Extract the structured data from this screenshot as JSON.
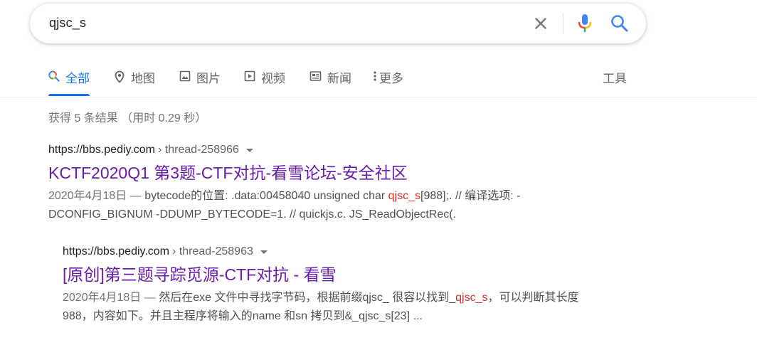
{
  "search": {
    "query": "qjsc_s"
  },
  "tabs": [
    {
      "label": "全部",
      "icon": "search-multicolor-icon",
      "active": true
    },
    {
      "label": "地图",
      "icon": "map-pin-icon"
    },
    {
      "label": "图片",
      "icon": "image-icon"
    },
    {
      "label": "视频",
      "icon": "video-play-icon"
    },
    {
      "label": "新闻",
      "icon": "news-icon"
    },
    {
      "label": "更多",
      "icon": "more-vert-icon"
    }
  ],
  "tools_label": "工具",
  "result_stats": "获得 5 条结果 （用时 0.29 秒）",
  "results": [
    {
      "domain": "https://bbs.pediy.com",
      "path": "› thread-258966",
      "title": "KCTF2020Q1 第3题-CTF对抗-看雪论坛-安全社区",
      "date": "2020年4月18日 —",
      "snippet_pre": " bytecode的位置: .data:00458040 unsigned char ",
      "snippet_hl": "qjsc_s",
      "snippet_post": "[988];. // 编译选项: -DCONFIG_BIGNUM -DDUMP_BYTECODE=1. // quickjs.c. JS_ReadObjectRec(."
    },
    {
      "domain": "https://bbs.pediy.com",
      "path": "› thread-258963",
      "title": "[原创]第三题寻踪觅源-CTF对抗 - 看雪",
      "date": "2020年4月18日 —",
      "snippet_pre": " 然后在exe 文件中寻找字节码，根据前缀qjsc_ 很容以找到_",
      "snippet_hl": "qjsc_s",
      "snippet_post": "，可以判断其长度988，内容如下。并且主程序将输入的name 和sn 拷贝到&_qjsc_s[23] ..."
    }
  ],
  "colors": {
    "accent": "#1a73e8",
    "visited_link": "#681da8",
    "highlight": "#d93025"
  }
}
